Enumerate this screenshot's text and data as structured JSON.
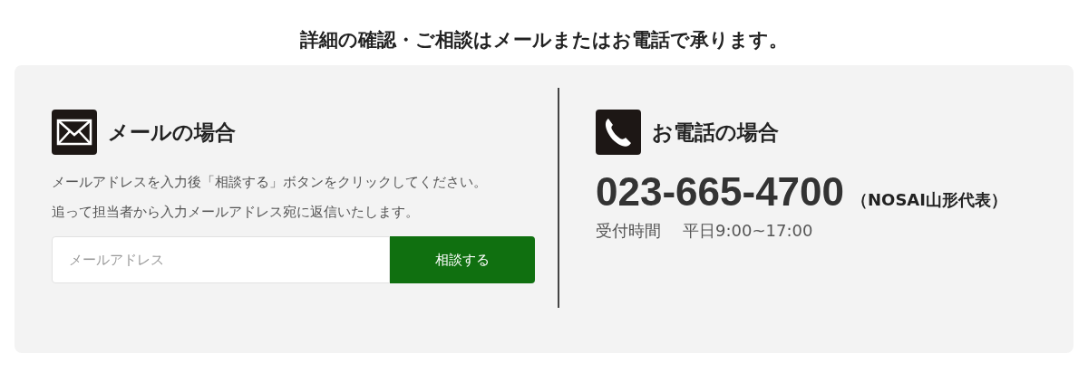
{
  "heading": "詳細の確認・ご相談はメールまたはお電話で承ります。",
  "email": {
    "title": "メールの場合",
    "paragraphs": [
      "メールアドレスを入力後「相談する」ボタンをクリックしてください。",
      "追って担当者から入力メールアドレス宛に返信いたします。"
    ],
    "field": {
      "placeholder": "メールアドレス"
    },
    "button": "相談する"
  },
  "phone": {
    "title": "お電話の場合",
    "number": "023-665-4700",
    "note": "（NOSAI山形代表）",
    "hours_label": "受付時間",
    "hours": "平日9:00~17:00"
  }
}
